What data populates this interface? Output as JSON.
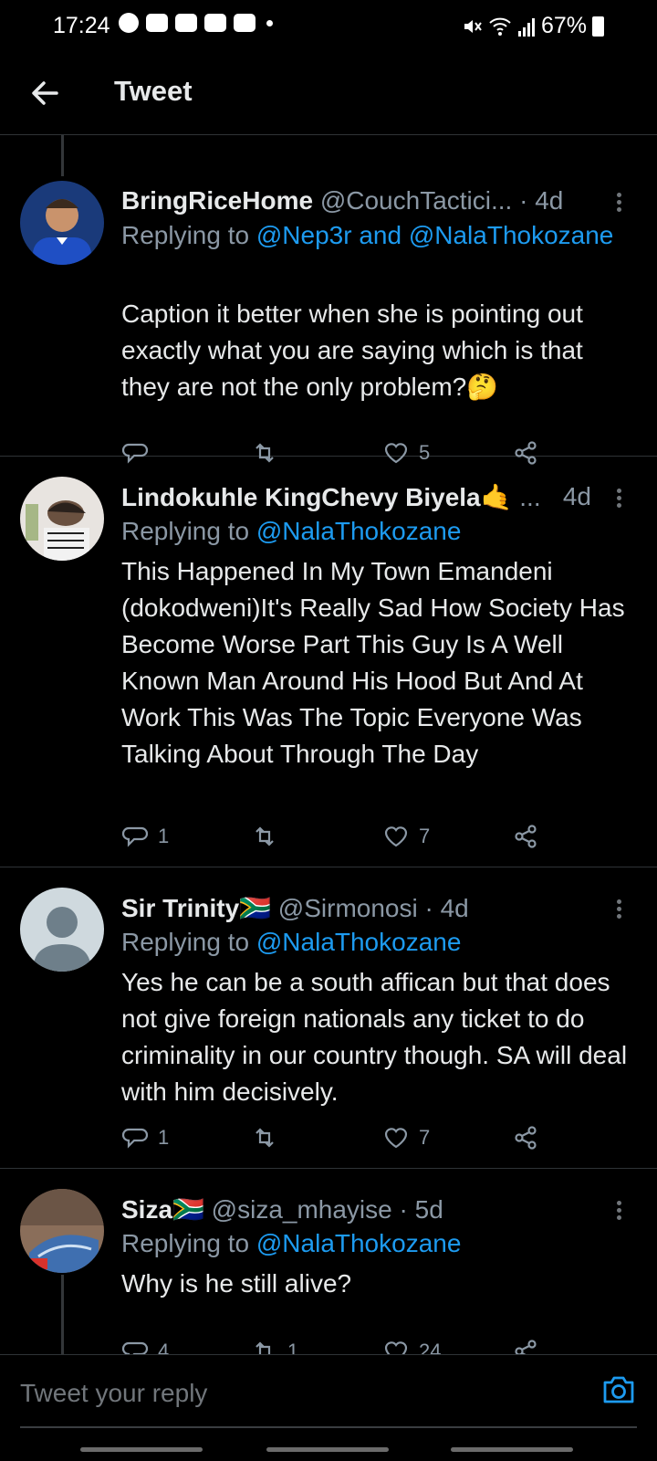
{
  "status": {
    "time": "17:24",
    "battery": "67%"
  },
  "header": {
    "title": "Tweet"
  },
  "tweets": [
    {
      "name": "BringRiceHome",
      "handle": "@CouchTactici...",
      "time": "· 4d",
      "reply_prefix": "Replying to ",
      "mentions": "@Nep3r and @NalaThokozane",
      "body": "Caption it better when she is pointing out exactly what you are saying which is that they are not the only problem?🤔",
      "replies": "",
      "retweets": "",
      "likes": "5"
    },
    {
      "name": "Lindokuhle KingChevy Biyela🤙",
      "handle": "...",
      "time": "4d",
      "reply_prefix": "Replying to ",
      "mentions": "@NalaThokozane",
      "body": "This Happened In My Town Emandeni (dokodweni)It's Really Sad How Society Has Become Worse Part This Guy Is A Well Known Man Around His Hood But And At Work This Was The Topic Everyone Was Talking About Through The Day",
      "replies": "1",
      "retweets": "",
      "likes": "7"
    },
    {
      "name": "Sir Trinity🇿🇦",
      "handle": "@Sirmonosi",
      "time": "· 4d",
      "reply_prefix": "Replying to ",
      "mentions": "@NalaThokozane",
      "body": "Yes he can be a south affican but that does not give foreign nationals any ticket to do criminality in our country though. SA will deal with him decisively.",
      "replies": "1",
      "retweets": "",
      "likes": "7"
    },
    {
      "name": "Siza🇿🇦",
      "handle": "@siza_mhayise",
      "time": "· 5d",
      "reply_prefix": "Replying to ",
      "mentions": "@NalaThokozane",
      "body": "Why is he still alive?",
      "replies": "4",
      "retweets": "1",
      "likes": "24"
    }
  ],
  "reply_bar": {
    "placeholder": "Tweet your reply"
  },
  "icons": {
    "back": "arrow-left-icon",
    "reply": "speech-bubble-icon",
    "retweet": "retweet-icon",
    "like": "heart-icon",
    "share": "share-icon",
    "camera": "camera-icon",
    "more": "more-vertical-icon"
  },
  "colors": {
    "background": "#000000",
    "accent": "#1d9bf0",
    "muted": "#8b98a5",
    "text": "#e7e9ea",
    "divider": "#2f3336"
  }
}
